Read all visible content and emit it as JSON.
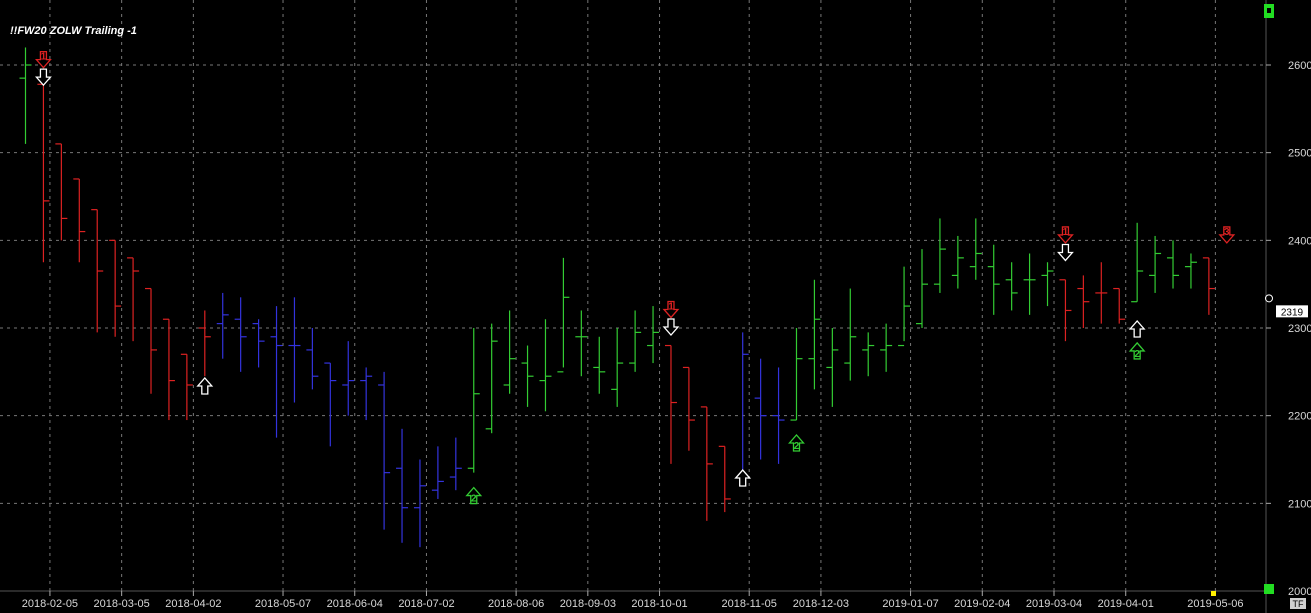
{
  "chart_data": {
    "type": "ohlc",
    "title": "!!FW20 ZOLW Trailing -1",
    "ylim": [
      2000,
      2620
    ],
    "yticks": [
      2000,
      2100,
      2200,
      2300,
      2400,
      2500,
      2600
    ],
    "x_tick_labels": [
      "2018-02-05",
      "2018-03-05",
      "2018-04-02",
      "2018-05-07",
      "2018-06-04",
      "2018-07-02",
      "2018-08-06",
      "2018-09-03",
      "2018-10-01",
      "2018-11-05",
      "2018-12-03",
      "2019-01-07",
      "2019-02-04",
      "2019-03-04",
      "2019-04-01",
      "2019-05-06"
    ],
    "last_value_label": "2319",
    "corner_label": "TF",
    "grid": true,
    "colors": {
      "up": "#33cc33",
      "down": "#dd2222",
      "neutral": "#3333dd",
      "background": "#000000",
      "grid": "#777777",
      "axis": "#aaaaaa"
    },
    "bars": [
      {
        "date": "2018-01-29",
        "o": 2585,
        "h": 2620,
        "l": 2510,
        "c": 2600,
        "color": "up"
      },
      {
        "date": "2018-02-05",
        "o": 2578,
        "h": 2578,
        "l": 2375,
        "c": 2445,
        "color": "down"
      },
      {
        "date": "2018-02-12",
        "o": 2510,
        "h": 2510,
        "l": 2400,
        "c": 2425,
        "color": "down"
      },
      {
        "date": "2018-02-19",
        "o": 2470,
        "h": 2470,
        "l": 2375,
        "c": 2410,
        "color": "down"
      },
      {
        "date": "2018-02-26",
        "o": 2435,
        "h": 2435,
        "l": 2295,
        "c": 2365,
        "color": "down"
      },
      {
        "date": "2018-03-05",
        "o": 2400,
        "h": 2400,
        "l": 2290,
        "c": 2325,
        "color": "down"
      },
      {
        "date": "2018-03-12",
        "o": 2380,
        "h": 2380,
        "l": 2285,
        "c": 2365,
        "color": "down"
      },
      {
        "date": "2018-03-19",
        "o": 2345,
        "h": 2345,
        "l": 2225,
        "c": 2275,
        "color": "down"
      },
      {
        "date": "2018-03-26",
        "o": 2310,
        "h": 2310,
        "l": 2195,
        "c": 2240,
        "color": "down"
      },
      {
        "date": "2018-04-02",
        "o": 2270,
        "h": 2270,
        "l": 2195,
        "c": 2235,
        "color": "down"
      },
      {
        "date": "2018-04-09",
        "o": 2300,
        "h": 2320,
        "l": 2245,
        "c": 2290,
        "color": "down"
      },
      {
        "date": "2018-04-16",
        "o": 2305,
        "h": 2340,
        "l": 2265,
        "c": 2315,
        "color": "neutral"
      },
      {
        "date": "2018-04-23",
        "o": 2310,
        "h": 2335,
        "l": 2250,
        "c": 2290,
        "color": "neutral"
      },
      {
        "date": "2018-04-30",
        "o": 2305,
        "h": 2310,
        "l": 2255,
        "c": 2285,
        "color": "neutral"
      },
      {
        "date": "2018-05-07",
        "o": 2290,
        "h": 2325,
        "l": 2175,
        "c": 2280,
        "color": "neutral"
      },
      {
        "date": "2018-05-14",
        "o": 2280,
        "h": 2335,
        "l": 2215,
        "c": 2280,
        "color": "neutral"
      },
      {
        "date": "2018-05-21",
        "o": 2275,
        "h": 2300,
        "l": 2230,
        "c": 2245,
        "color": "neutral"
      },
      {
        "date": "2018-05-28",
        "o": 2260,
        "h": 2260,
        "l": 2165,
        "c": 2240,
        "color": "neutral"
      },
      {
        "date": "2018-06-04",
        "o": 2235,
        "h": 2285,
        "l": 2200,
        "c": 2240,
        "color": "neutral"
      },
      {
        "date": "2018-06-11",
        "o": 2240,
        "h": 2255,
        "l": 2195,
        "c": 2245,
        "color": "neutral"
      },
      {
        "date": "2018-06-18",
        "o": 2235,
        "h": 2250,
        "l": 2070,
        "c": 2135,
        "color": "neutral"
      },
      {
        "date": "2018-06-25",
        "o": 2140,
        "h": 2185,
        "l": 2055,
        "c": 2095,
        "color": "neutral"
      },
      {
        "date": "2018-07-02",
        "o": 2095,
        "h": 2150,
        "l": 2050,
        "c": 2120,
        "color": "neutral"
      },
      {
        "date": "2018-07-09",
        "o": 2115,
        "h": 2165,
        "l": 2105,
        "c": 2125,
        "color": "neutral"
      },
      {
        "date": "2018-07-16",
        "o": 2130,
        "h": 2175,
        "l": 2115,
        "c": 2140,
        "color": "neutral"
      },
      {
        "date": "2018-07-23",
        "o": 2140,
        "h": 2300,
        "l": 2135,
        "c": 2225,
        "color": "up"
      },
      {
        "date": "2018-07-30",
        "o": 2185,
        "h": 2305,
        "l": 2180,
        "c": 2285,
        "color": "up"
      },
      {
        "date": "2018-08-06",
        "o": 2235,
        "h": 2320,
        "l": 2225,
        "c": 2265,
        "color": "up"
      },
      {
        "date": "2018-08-13",
        "o": 2260,
        "h": 2280,
        "l": 2210,
        "c": 2245,
        "color": "up"
      },
      {
        "date": "2018-08-20",
        "o": 2240,
        "h": 2310,
        "l": 2205,
        "c": 2245,
        "color": "up"
      },
      {
        "date": "2018-08-27",
        "o": 2250,
        "h": 2380,
        "l": 2255,
        "c": 2335,
        "color": "up"
      },
      {
        "date": "2018-09-03",
        "o": 2290,
        "h": 2320,
        "l": 2245,
        "c": 2290,
        "color": "up"
      },
      {
        "date": "2018-09-10",
        "o": 2255,
        "h": 2290,
        "l": 2225,
        "c": 2250,
        "color": "up"
      },
      {
        "date": "2018-09-17",
        "o": 2230,
        "h": 2300,
        "l": 2210,
        "c": 2260,
        "color": "up"
      },
      {
        "date": "2018-09-24",
        "o": 2260,
        "h": 2320,
        "l": 2250,
        "c": 2295,
        "color": "up"
      },
      {
        "date": "2018-10-01",
        "o": 2280,
        "h": 2325,
        "l": 2260,
        "c": 2295,
        "color": "up"
      },
      {
        "date": "2018-10-08",
        "o": 2280,
        "h": 2280,
        "l": 2145,
        "c": 2215,
        "color": "down"
      },
      {
        "date": "2018-10-15",
        "o": 2255,
        "h": 2255,
        "l": 2160,
        "c": 2195,
        "color": "down"
      },
      {
        "date": "2018-10-22",
        "o": 2210,
        "h": 2210,
        "l": 2080,
        "c": 2145,
        "color": "down"
      },
      {
        "date": "2018-10-29",
        "o": 2165,
        "h": 2165,
        "l": 2090,
        "c": 2105,
        "color": "down"
      },
      {
        "date": "2018-11-05",
        "o": 2130,
        "h": 2295,
        "l": 2135,
        "c": 2270,
        "color": "neutral"
      },
      {
        "date": "2018-11-12",
        "o": 2220,
        "h": 2265,
        "l": 2150,
        "c": 2200,
        "color": "neutral"
      },
      {
        "date": "2018-11-19",
        "o": 2200,
        "h": 2255,
        "l": 2145,
        "c": 2195,
        "color": "neutral"
      },
      {
        "date": "2018-11-26",
        "o": 2195,
        "h": 2300,
        "l": 2195,
        "c": 2265,
        "color": "up"
      },
      {
        "date": "2018-12-03",
        "o": 2265,
        "h": 2355,
        "l": 2230,
        "c": 2310,
        "color": "up"
      },
      {
        "date": "2018-12-10",
        "o": 2255,
        "h": 2300,
        "l": 2210,
        "c": 2275,
        "color": "up"
      },
      {
        "date": "2018-12-17",
        "o": 2260,
        "h": 2345,
        "l": 2240,
        "c": 2290,
        "color": "up"
      },
      {
        "date": "2018-12-24",
        "o": 2275,
        "h": 2295,
        "l": 2245,
        "c": 2280,
        "color": "up"
      },
      {
        "date": "2018-12-31",
        "o": 2275,
        "h": 2305,
        "l": 2250,
        "c": 2280,
        "color": "up"
      },
      {
        "date": "2019-01-07",
        "o": 2280,
        "h": 2370,
        "l": 2285,
        "c": 2325,
        "color": "up"
      },
      {
        "date": "2019-01-14",
        "o": 2305,
        "h": 2390,
        "l": 2300,
        "c": 2350,
        "color": "up"
      },
      {
        "date": "2019-01-21",
        "o": 2350,
        "h": 2425,
        "l": 2340,
        "c": 2390,
        "color": "up"
      },
      {
        "date": "2019-01-28",
        "o": 2360,
        "h": 2405,
        "l": 2345,
        "c": 2380,
        "color": "up"
      },
      {
        "date": "2019-02-04",
        "o": 2370,
        "h": 2425,
        "l": 2355,
        "c": 2385,
        "color": "up"
      },
      {
        "date": "2019-02-11",
        "o": 2370,
        "h": 2395,
        "l": 2315,
        "c": 2350,
        "color": "up"
      },
      {
        "date": "2019-02-18",
        "o": 2355,
        "h": 2375,
        "l": 2320,
        "c": 2340,
        "color": "up"
      },
      {
        "date": "2019-02-25",
        "o": 2355,
        "h": 2385,
        "l": 2315,
        "c": 2355,
        "color": "up"
      },
      {
        "date": "2019-03-04",
        "o": 2360,
        "h": 2375,
        "l": 2325,
        "c": 2365,
        "color": "up"
      },
      {
        "date": "2019-03-11",
        "o": 2355,
        "h": 2355,
        "l": 2285,
        "c": 2320,
        "color": "down"
      },
      {
        "date": "2019-03-18",
        "o": 2345,
        "h": 2360,
        "l": 2300,
        "c": 2330,
        "color": "down"
      },
      {
        "date": "2019-03-25",
        "o": 2340,
        "h": 2375,
        "l": 2305,
        "c": 2340,
        "color": "down"
      },
      {
        "date": "2019-04-01",
        "o": 2345,
        "h": 2345,
        "l": 2305,
        "c": 2310,
        "color": "down"
      },
      {
        "date": "2019-04-08",
        "o": 2330,
        "h": 2420,
        "l": 2330,
        "c": 2365,
        "color": "up"
      },
      {
        "date": "2019-04-15",
        "o": 2360,
        "h": 2405,
        "l": 2340,
        "c": 2385,
        "color": "up"
      },
      {
        "date": "2019-04-22",
        "o": 2380,
        "h": 2400,
        "l": 2345,
        "c": 2360,
        "color": "up"
      },
      {
        "date": "2019-04-29",
        "o": 2370,
        "h": 2385,
        "l": 2345,
        "c": 2375,
        "color": "up"
      },
      {
        "date": "2019-05-06",
        "o": 2380,
        "h": 2380,
        "l": 2315,
        "c": 2345,
        "color": "down"
      }
    ],
    "signals": [
      {
        "bar": 1,
        "dir": "down",
        "label": "1",
        "color": "#dd2222",
        "price": 2605
      },
      {
        "bar": 1,
        "dir": "down",
        "label": "",
        "color": "#ffffff",
        "price": 2585
      },
      {
        "bar": 10,
        "dir": "up",
        "label": "",
        "color": "#ffffff",
        "price": 2235
      },
      {
        "bar": 25,
        "dir": "up",
        "label": "2",
        "color": "#33cc33",
        "price": 2110
      },
      {
        "bar": 36,
        "dir": "down",
        "label": "1",
        "color": "#dd2222",
        "price": 2320
      },
      {
        "bar": 36,
        "dir": "down",
        "label": "",
        "color": "#ffffff",
        "price": 2300
      },
      {
        "bar": 40,
        "dir": "up",
        "label": "",
        "color": "#ffffff",
        "price": 2130
      },
      {
        "bar": 43,
        "dir": "up",
        "label": "2",
        "color": "#33cc33",
        "price": 2170
      },
      {
        "bar": 58,
        "dir": "down",
        "label": "1",
        "color": "#dd2222",
        "price": 2405
      },
      {
        "bar": 58,
        "dir": "down",
        "label": "",
        "color": "#ffffff",
        "price": 2385
      },
      {
        "bar": 62,
        "dir": "up",
        "label": "",
        "color": "#ffffff",
        "price": 2300
      },
      {
        "bar": 62,
        "dir": "up",
        "label": "2",
        "color": "#33cc33",
        "price": 2275
      },
      {
        "bar": 67,
        "dir": "down",
        "label": "3",
        "color": "#dd2222",
        "price": 2405
      }
    ]
  }
}
